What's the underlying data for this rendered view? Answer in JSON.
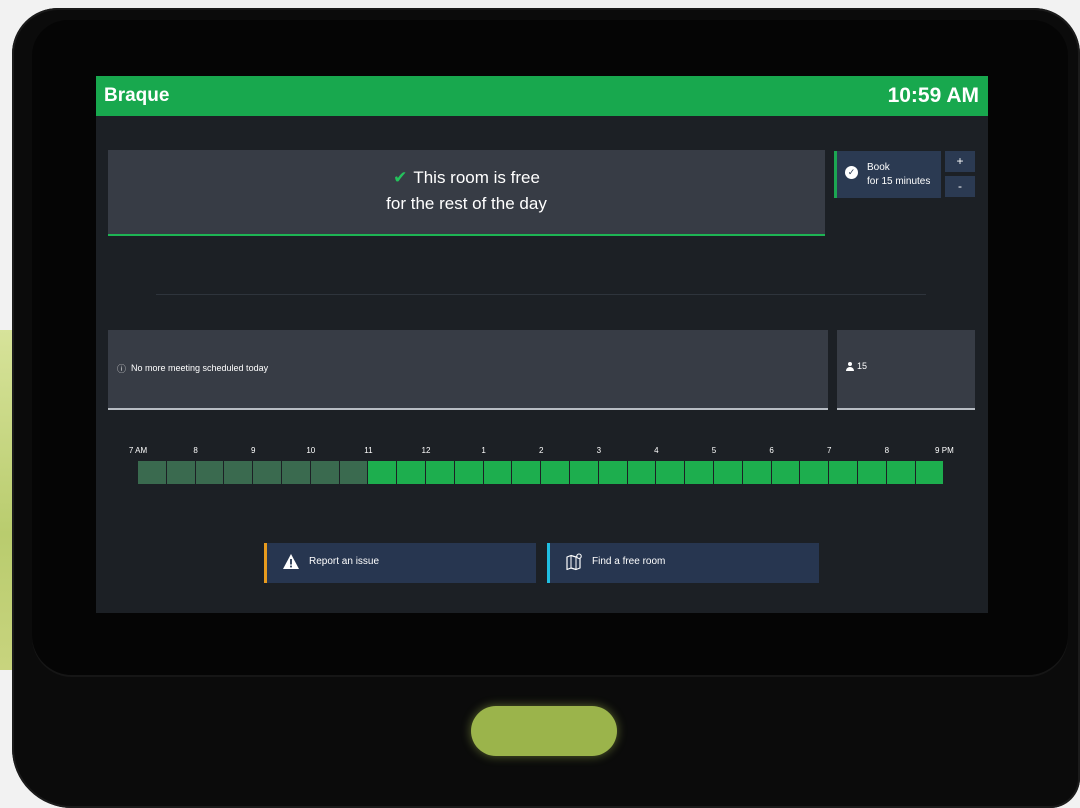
{
  "header": {
    "room_name": "Braque",
    "time": "10:59 AM"
  },
  "status": {
    "icon": "check-icon",
    "line1": "This room is free",
    "line2": "for the rest of the day",
    "accent_color": "#1eb454"
  },
  "booking": {
    "title": "Book",
    "duration": "for 15 minutes",
    "plus": "+",
    "minus": "-"
  },
  "meetings": {
    "message": "No more meeting scheduled today",
    "icon": "info-icon"
  },
  "room": {
    "capacity": "15",
    "icon": "person-icon"
  },
  "timeline": {
    "labels": [
      "7 AM",
      "8",
      "9",
      "10",
      "11",
      "12",
      "1",
      "2",
      "3",
      "4",
      "5",
      "6",
      "7",
      "8",
      "9 PM"
    ],
    "slots_per_hour": 2,
    "past_slots": 8,
    "future_slots": 20,
    "past_color": "#3a6a4f",
    "free_color": "#1dae4e"
  },
  "actions": [
    {
      "label": "Report an issue",
      "icon": "warning-icon",
      "accent": "#e79b1e"
    },
    {
      "label": "Find a free room",
      "icon": "map-icon",
      "accent": "#20bde0"
    }
  ],
  "brand_color": "#18a84e"
}
